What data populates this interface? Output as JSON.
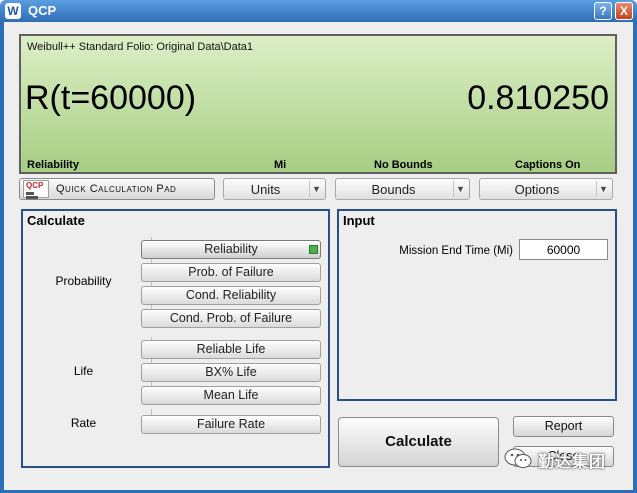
{
  "window": {
    "title": "QCP",
    "app_icon": "W",
    "help_label": "?",
    "close_label": "X"
  },
  "display": {
    "source": "Weibull++ Standard Folio: Original Data\\Data1",
    "expression": "R(t=60000)",
    "value": "0.810250",
    "status": [
      "Reliability",
      "Mi",
      "No Bounds",
      "Captions On"
    ]
  },
  "toolbar": {
    "qcp_logo": "QCP",
    "qcp_label": "Quick Calculation Pad",
    "units_label": "Units",
    "bounds_label": "Bounds",
    "options_label": "Options"
  },
  "calculate": {
    "title": "Calculate",
    "groups": [
      {
        "label": "Probability",
        "buttons": [
          "Reliability",
          "Prob. of Failure",
          "Cond. Reliability",
          "Cond. Prob. of Failure"
        ]
      },
      {
        "label": "Life",
        "buttons": [
          "Reliable Life",
          "BX% Life",
          "Mean Life"
        ]
      },
      {
        "label": "Rate",
        "buttons": [
          "Failure Rate"
        ]
      }
    ],
    "selected": "Reliability"
  },
  "input": {
    "title": "Input",
    "mission_end_time_label": "Mission End Time (Mi)",
    "mission_end_time_value": "60000"
  },
  "actions": {
    "calculate_label": "Calculate",
    "report_label": "Report",
    "close_label": "Close"
  },
  "watermark": {
    "text": "勤达集团"
  },
  "colors": {
    "lcd": "#b9dc98",
    "group_border": "#2a4f86",
    "title_bar": "#2f6cb4",
    "selected_marker": "#49b04c"
  }
}
